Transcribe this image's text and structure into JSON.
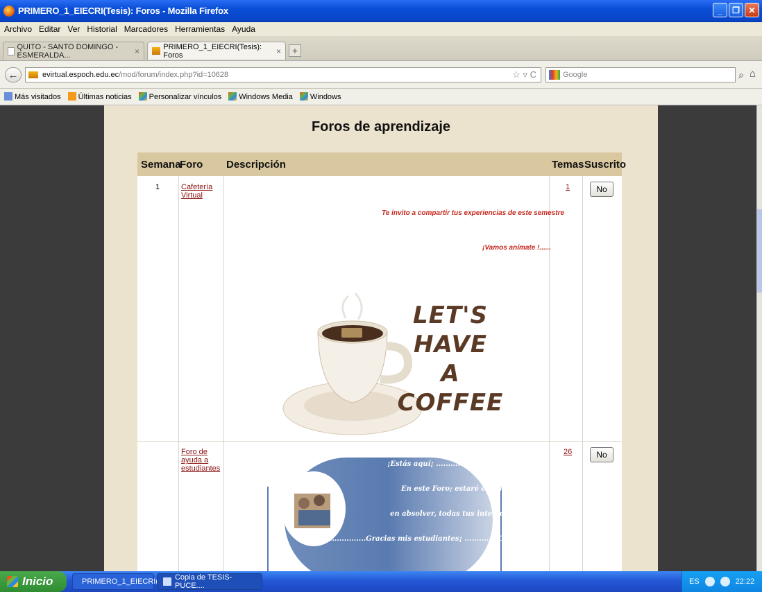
{
  "window": {
    "title": "PRIMERO_1_EIECRI(Tesis): Foros - Mozilla Firefox"
  },
  "menu": [
    "Archivo",
    "Editar",
    "Ver",
    "Historial",
    "Marcadores",
    "Herramientas",
    "Ayuda"
  ],
  "tabs": [
    {
      "label": "QUITO - SANTO DOMINGO - ESMERALDA...",
      "close": "×"
    },
    {
      "label": "PRIMERO_1_EIECRI(Tesis): Foros",
      "close": "×"
    }
  ],
  "newtab_label": "+",
  "nav": {
    "url_domain": "evirtual.espoch.edu.ec",
    "url_path": "/mod/forum/index.php?id=10628",
    "url_tools": "☆ ▿ C",
    "search_placeholder": "Google"
  },
  "bookmarks": [
    "Más visitados",
    "Últimas noticias",
    "Personalizar vínculos",
    "Windows Media",
    "Windows"
  ],
  "page": {
    "title": "Foros de aprendizaje",
    "headers": [
      "Semana",
      "Foro",
      "Descripción",
      "Temas",
      "Suscrito"
    ],
    "rows": [
      {
        "week": "1",
        "forum": [
          "Cafetería",
          "Virtual"
        ],
        "topics": "1",
        "subscribed": "No",
        "desc_line1": "Te invito a compartir tus experiencias de este semestre",
        "desc_line2": "¡Vamos anímate !......",
        "image_text": [
          "LET'S",
          "HAVE",
          "A COFFEE"
        ]
      },
      {
        "week": "",
        "forum": [
          "Foro de",
          "ayuda a",
          "estudiantes"
        ],
        "topics": "26",
        "subscribed": "No",
        "banner_lines": [
          "¡Estás aquí¡ ............¡qué bien llegaste¡",
          "En este Foro; estaré encantada",
          "en absolver, todas tus interrogantes",
          ".................Gracias mis estudiantes¡ ..............Carmita"
        ]
      }
    ]
  },
  "taskbar": {
    "start": "Inicio",
    "tasks": [
      "PRIMERO_1_EIECRI(...",
      "Copia de TESIS-PUCE...."
    ],
    "lang": "ES",
    "clock": "22:22"
  },
  "colors": {
    "titlebar": "#0a4fd8",
    "page_bg": "#ebe3cd",
    "header_bg": "#d8c79f",
    "link": "#8b1111",
    "invite": "#c4261b"
  }
}
